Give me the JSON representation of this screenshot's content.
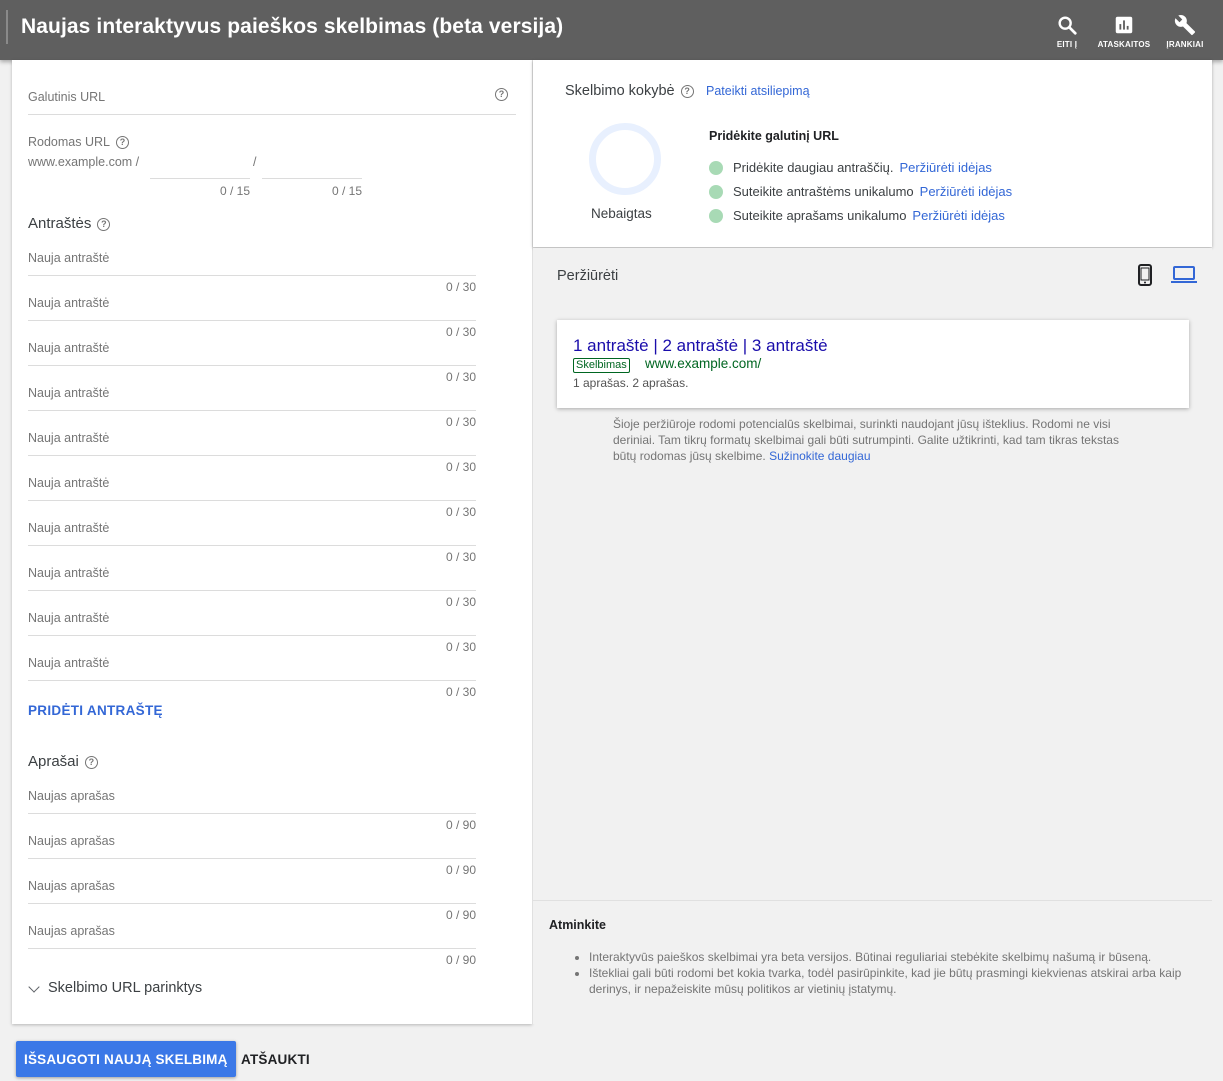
{
  "header": {
    "title": "Naujas interaktyvus paieškos skelbimas (beta versija)",
    "buttons": [
      {
        "label": "EITI Į",
        "icon": "search-icon"
      },
      {
        "label": "ATASKAITOS",
        "icon": "reports-icon"
      },
      {
        "label": "ĮRANKIAI",
        "icon": "wrench-icon"
      }
    ]
  },
  "form": {
    "final_url": {
      "label": "Galutinis URL",
      "value": ""
    },
    "display_url": {
      "label": "Rodomas URL",
      "prefix": "www.example.com /",
      "separator": "/",
      "path1_counter": "0 / 15",
      "path2_counter": "0 / 15"
    },
    "headlines": {
      "title": "Antraštės",
      "placeholder": "Nauja antraštė",
      "counter": "0 / 30",
      "items": [
        "Nauja antraštė",
        "Nauja antraštė",
        "Nauja antraštė",
        "Nauja antraštė",
        "Nauja antraštė",
        "Nauja antraštė",
        "Nauja antraštė",
        "Nauja antraštė",
        "Nauja antraštė",
        "Nauja antraštė"
      ],
      "add_label": "PRIDĖTI ANTRAŠTĘ"
    },
    "descriptions": {
      "title": "Aprašai",
      "placeholder": "Naujas aprašas",
      "counter": "0 / 90",
      "items": [
        "Naujas aprašas",
        "Naujas aprašas",
        "Naujas aprašas",
        "Naujas aprašas"
      ]
    },
    "url_options_label": "Skelbimo URL parinktys"
  },
  "quality": {
    "title": "Skelbimo kokybė",
    "feedback_link": "Pateikti atsiliepimą",
    "status": "Nebaigtas",
    "heading": "Pridėkite galutinį URL",
    "items": [
      {
        "text": "Pridėkite daugiau antraščių.",
        "link": "Peržiūrėti idėjas"
      },
      {
        "text": "Suteikite antraštėms unikalumo",
        "link": "Peržiūrėti idėjas"
      },
      {
        "text": "Suteikite aprašams unikalumo",
        "link": "Peržiūrėti idėjas"
      }
    ],
    "colors": {
      "ring": "#e8f0fe",
      "dot": "#a8dab5"
    }
  },
  "preview": {
    "title": "Peržiūrėti",
    "ad": {
      "headline": "1 antraštė | 2 antraštė | 3 antraštė",
      "badge": "Skelbimas",
      "url": "www.example.com/",
      "description": "1 aprašas. 2 aprašas."
    },
    "note": "Šioje peržiūroje rodomi potencialūs skelbimai, surinkti naudojant jūsų išteklius. Rodomi ne visi deriniai. Tam tikrų formatų skelbimai gali būti sutrumpinti. Galite užtikrinti, kad tam tikras tekstas būtų rodomas jūsų skelbime.",
    "note_link": "Sužinokite daugiau"
  },
  "notes": {
    "title": "Atminkite",
    "items": [
      "Interaktyvūs paieškos skelbimai yra beta versijos. Būtinai reguliariai stebėkite skelbimų našumą ir būseną.",
      "Ištekliai gali būti rodomi bet kokia tvarka, todėl pasirūpinkite, kad jie būtų prasmingi kiekvienas atskirai arba kaip derinys, ir nepažeiskite mūsų politikos ar vietinių įstatymų."
    ]
  },
  "actions": {
    "save": "IŠSAUGOTI NAUJĄ SKELBIMĄ",
    "cancel": "ATŠAUKTI"
  },
  "colors": {
    "header_bg": "#5f5f5f",
    "accent": "#3367d6",
    "save_bg": "#3b78e7",
    "ad_headline": "#1a0dab",
    "ad_url": "#006621"
  }
}
